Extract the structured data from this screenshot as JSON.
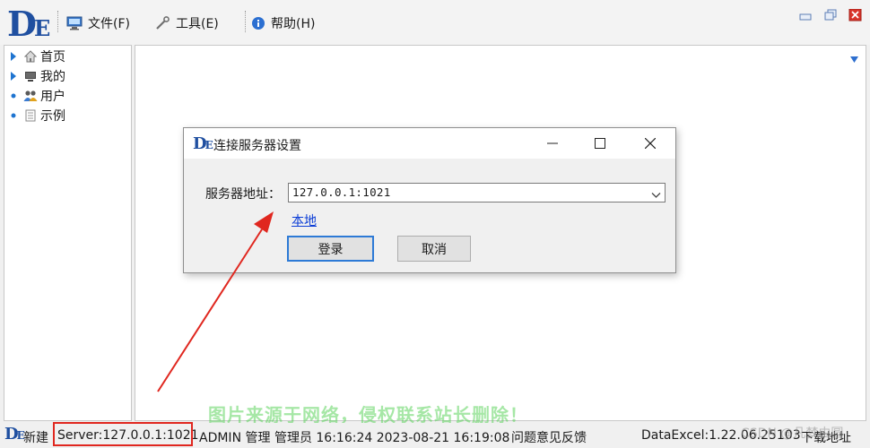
{
  "app": {
    "logo_d": "D",
    "logo_e": "E"
  },
  "menu": {
    "file": "文件(F)",
    "tools": "工具(E)",
    "help": "帮助(H)"
  },
  "tree": {
    "items": [
      {
        "label": "首页",
        "icon": "home-icon",
        "toggle": "triangle"
      },
      {
        "label": "我的",
        "icon": "monitor-icon",
        "toggle": "triangle"
      },
      {
        "label": "用户",
        "icon": "users-icon",
        "toggle": "dot"
      },
      {
        "label": "示例",
        "icon": "document-icon",
        "toggle": "dot"
      }
    ]
  },
  "dialog": {
    "title": "连接服务器设置",
    "server_label": "服务器地址：",
    "server_value": "127.0.0.1:1021",
    "local_link": "本地",
    "login_button": "登录",
    "cancel_button": "取消"
  },
  "statusbar": {
    "new": "新建",
    "server": "Server:127.0.0.1:1021",
    "user_info": "ADMIN 管理 管理员 16:16:24 2023-08-21 16:19:08",
    "feedback": "问题意见反馈",
    "version": "DataExcel:1.22.06.25103",
    "download": "下载地址"
  },
  "watermarks": {
    "green": "图片来源于网络，侵权联系站长删除！",
    "csdn": "CSDN @凡梦由圆"
  },
  "colors": {
    "brand": "#1f4fa0",
    "highlight_red": "#e0271f",
    "link": "#0b3dd6",
    "focus_blue": "#2d7ad6"
  }
}
